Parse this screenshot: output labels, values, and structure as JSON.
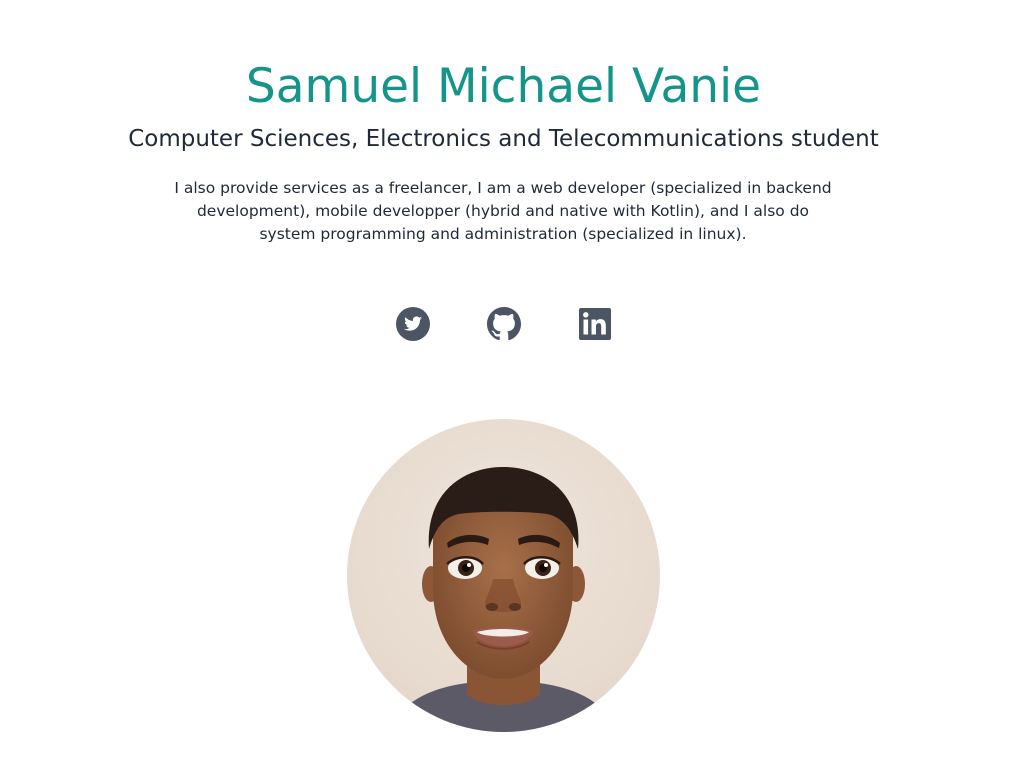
{
  "hero": {
    "name": "Samuel Michael Vanie",
    "title": "Computer Sciences, Electronics and Telecommunications student",
    "bio": "I also provide services as a freelancer, I am a web developer (specialized in backend development), mobile developper (hybrid and native with Kotlin), and I also do system programming and administration (specialized in linux)."
  },
  "social": [
    {
      "icon": "twitter-icon",
      "color": "#4b5563"
    },
    {
      "icon": "github-icon",
      "color": "#4b5563"
    },
    {
      "icon": "linkedin-icon",
      "color": "#4b5563"
    }
  ],
  "colors": {
    "accent": "#14958a",
    "text": "#1f2937",
    "icon": "#4b5563",
    "background": "#ffffff"
  }
}
